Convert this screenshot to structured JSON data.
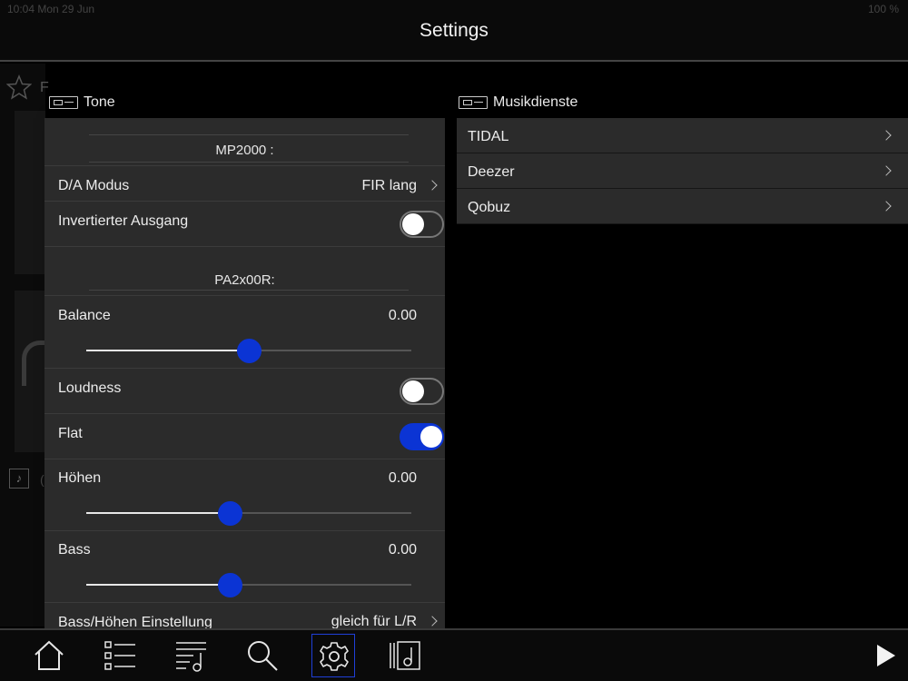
{
  "status": {
    "left": "10:04 Mon 29 Jun",
    "right": "100 %"
  },
  "header": {
    "title": "Settings"
  },
  "background": {
    "letter1": "F",
    "letter2": "("
  },
  "tone": {
    "title": "Tone",
    "mp2000_header": "MP2000 :",
    "da_mode": {
      "label": "D/A Modus",
      "value": "FIR lang"
    },
    "inverted_output": {
      "label": "Invertierter Ausgang",
      "on": false
    },
    "pa_header": "PA2x00R:",
    "balance": {
      "label": "Balance",
      "value": "0.00",
      "level": 0.5
    },
    "loudness": {
      "label": "Loudness",
      "on": false
    },
    "flat": {
      "label": "Flat",
      "on": true
    },
    "treble": {
      "label": "Höhen",
      "value": "0.00",
      "level": 0.44
    },
    "bass": {
      "label": "Bass",
      "value": "0.00",
      "level": 0.44
    },
    "bass_treble_setting": {
      "label": "Bass/Höhen Einstellung",
      "value": "gleich für L/R"
    }
  },
  "music_services": {
    "title": "Musikdienste",
    "items": [
      {
        "label": "TIDAL"
      },
      {
        "label": "Deezer"
      },
      {
        "label": "Qobuz"
      }
    ]
  },
  "tabbar": {
    "items": [
      "home-icon",
      "list-icon",
      "playlist-icon",
      "search-icon",
      "settings-icon",
      "music-library-icon",
      "play-icon"
    ],
    "active": "settings-icon"
  },
  "colors": {
    "accent": "#0b34d4",
    "panel": "#2b2b2b",
    "background": "#000000"
  }
}
